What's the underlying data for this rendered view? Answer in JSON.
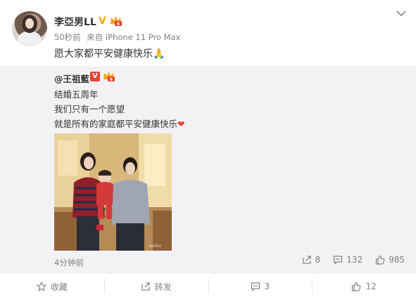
{
  "post": {
    "author": "李亞男LL",
    "time": "50秒前",
    "source": "来自 iPhone 11 Pro Max",
    "text": "愿大家都平安健康快乐",
    "emoji": "🙏"
  },
  "repost": {
    "author": "@王祖藍",
    "lines": [
      "结婚五周年",
      "我们只有一个愿望",
      "就是所有的家庭都平安健康快乐"
    ],
    "heart": "❤",
    "time": "4分钟前",
    "stats": {
      "reposts": "8",
      "comments": "132",
      "likes": "985"
    }
  },
  "actions": {
    "favorite": "收藏",
    "repost": "转发",
    "comment": "3",
    "like": "12"
  },
  "colors": {
    "accent": "#f5a623",
    "red": "#e8402f",
    "muted": "#808080",
    "repost_bg": "#f2f2f5"
  }
}
